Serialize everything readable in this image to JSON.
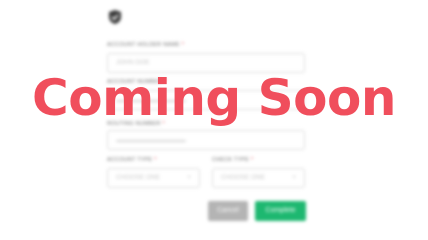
{
  "form": {
    "brand_icon": "shield-check-icon",
    "account_holder_name": {
      "label": "ACCOUNT HOLDER NAME",
      "placeholder": "JOHN DOE"
    },
    "account_number": {
      "label": "ACCOUNT NUMBER"
    },
    "routing_number": {
      "label": "ROUTING NUMBER"
    },
    "account_type": {
      "label": "ACCOUNT TYPE",
      "selected": "CHOOSE ONE"
    },
    "check_type": {
      "label": "CHECK TYPE",
      "selected": "CHOOSE ONE"
    },
    "required_marker": "*",
    "select_chevron": "÷",
    "cancel_label": "Cancel",
    "complete_label": "Complete"
  },
  "overlay": {
    "text": "Coming Soon",
    "color": "#f04e5c"
  },
  "colors": {
    "complete_button": "#1db870",
    "cancel_button": "#b4b4b4"
  }
}
